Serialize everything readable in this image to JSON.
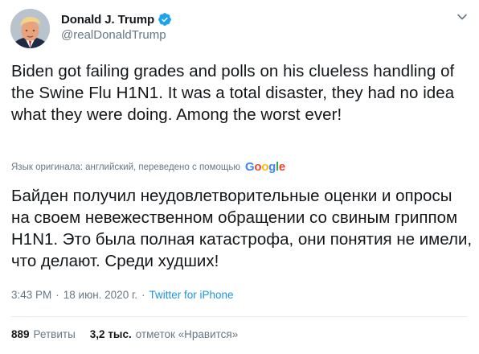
{
  "author": {
    "display_name": "Donald J. Trump",
    "handle": "@realDonaldTrump",
    "verified": true
  },
  "tweet": {
    "text": "Biden got failing grades and polls on his clueless handling of the Swine Flu H1N1. It was a total disaster, they had no idea what they were doing. Among the worst ever!",
    "translation_note": "Язык оригинала: английский, переведено с помощью",
    "translated_text": "Байден получил неудовлетворительные оценки и опросы на своем невежественном обращении со свиным гриппом H1N1. Это была полная катастрофа, они понятия не имели, что делают. Среди худших!"
  },
  "google_logo": [
    "G",
    "o",
    "o",
    "g",
    "l",
    "e"
  ],
  "meta": {
    "time": "3:43 PM",
    "separator": "·",
    "date": "18 июн. 2020 г.",
    "source": "Twitter for iPhone"
  },
  "stats": {
    "retweets_count": "889",
    "retweets_label": "Ретвиты",
    "likes_count": "3,2 тыс.",
    "likes_label": "отметок «Нравится»"
  },
  "colors": {
    "text": "#14171a",
    "secondary": "#657786",
    "link": "#1b95e0",
    "verified": "#1da1f2",
    "divider": "#e6ecf0",
    "google_blue": "#4285f4",
    "google_red": "#ea4335",
    "google_yellow": "#fbbc05",
    "google_green": "#34a853"
  },
  "icons": {
    "verified": "verified-badge-icon",
    "caret": "chevron-down-icon",
    "avatar": "profile-photo"
  }
}
